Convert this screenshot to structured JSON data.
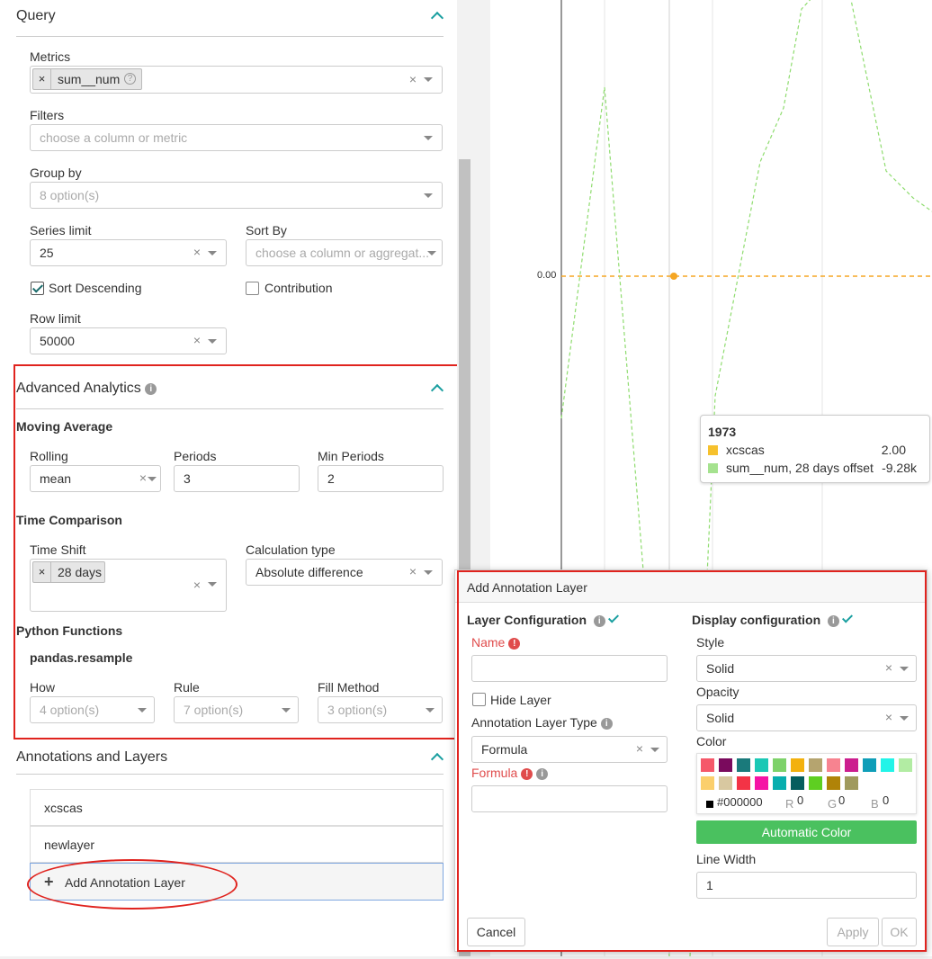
{
  "query": {
    "title": "Query",
    "metrics": {
      "label": "Metrics",
      "tags": [
        "sum__num"
      ],
      "help_icon": "question-circle-icon"
    },
    "filters": {
      "label": "Filters",
      "placeholder": "choose a column or metric"
    },
    "group_by": {
      "label": "Group by",
      "placeholder": "8 option(s)"
    },
    "series_limit": {
      "label": "Series limit",
      "value": "25"
    },
    "sort_by": {
      "label": "Sort By",
      "placeholder": "choose a column or aggregat..."
    },
    "sort_descending": {
      "label": "Sort Descending",
      "checked": true
    },
    "contribution": {
      "label": "Contribution",
      "checked": false
    },
    "row_limit": {
      "label": "Row limit",
      "value": "50000"
    }
  },
  "advanced_analytics": {
    "title": "Advanced Analytics",
    "moving_average": {
      "title": "Moving Average",
      "rolling_label": "Rolling",
      "rolling_value": "mean",
      "periods_label": "Periods",
      "periods_value": "3",
      "min_periods_label": "Min Periods",
      "min_periods_value": "2"
    },
    "time_comparison": {
      "title": "Time Comparison",
      "time_shift_label": "Time Shift",
      "time_shift_tags": [
        "28 days"
      ],
      "calc_type_label": "Calculation type",
      "calc_type_value": "Absolute difference"
    },
    "python_functions": {
      "title": "Python Functions",
      "subtitle": "pandas.resample",
      "how_label": "How",
      "how_placeholder": "4 option(s)",
      "rule_label": "Rule",
      "rule_placeholder": "7 option(s)",
      "fill_label": "Fill Method",
      "fill_placeholder": "3 option(s)"
    }
  },
  "annotations": {
    "title": "Annotations and Layers",
    "layers": [
      "xcscas",
      "newlayer"
    ],
    "add_label": "Add Annotation Layer"
  },
  "chart": {
    "y_tick_label": "0.00",
    "tooltip": {
      "title": "1973",
      "rows": [
        {
          "name": "xcscas",
          "value": "2.00",
          "color": "#f6c12d"
        },
        {
          "name": "sum__num, 28 days offset",
          "value": "-9.28k",
          "color": "#a5e28f"
        }
      ]
    },
    "line_color": "#8fdc6f",
    "annotation_color": "#f5a623"
  },
  "popover": {
    "title": "Add Annotation Layer",
    "layer_config": {
      "title": "Layer Configuration",
      "name_label": "Name",
      "name_value": "",
      "hide_layer_label": "Hide Layer",
      "hide_layer_checked": false,
      "type_label": "Annotation Layer Type",
      "type_value": "Formula",
      "formula_label": "Formula",
      "formula_value": ""
    },
    "display_config": {
      "title": "Display configuration",
      "style_label": "Style",
      "style_value": "Solid",
      "opacity_label": "Opacity",
      "opacity_value": "Solid",
      "color_label": "Color",
      "swatches_row1": [
        "#f5586a",
        "#7a0a5d",
        "#1a7a7b",
        "#1bc8b5",
        "#7ed26a",
        "#f3b10e",
        "#b5a46f",
        "#f78390",
        "#cc1e8e",
        "#0f9eb8",
        "#22f4e8",
        "#b2eca3"
      ],
      "swatches_row2": [
        "#fbcf6c",
        "#d8c8a0",
        "#f33346",
        "#f514a5",
        "#08aeae",
        "#055d5e",
        "#5ecf21",
        "#b08308",
        "#a09a5d"
      ],
      "hex_value": "#000000",
      "r_label": "R",
      "r_value": "0",
      "g_label": "G",
      "g_value": "0",
      "b_label": "B",
      "b_value": "0",
      "auto_color_label": "Automatic Color",
      "line_width_label": "Line Width",
      "line_width_value": "1"
    },
    "cancel_label": "Cancel",
    "apply_label": "Apply",
    "ok_label": "OK"
  }
}
